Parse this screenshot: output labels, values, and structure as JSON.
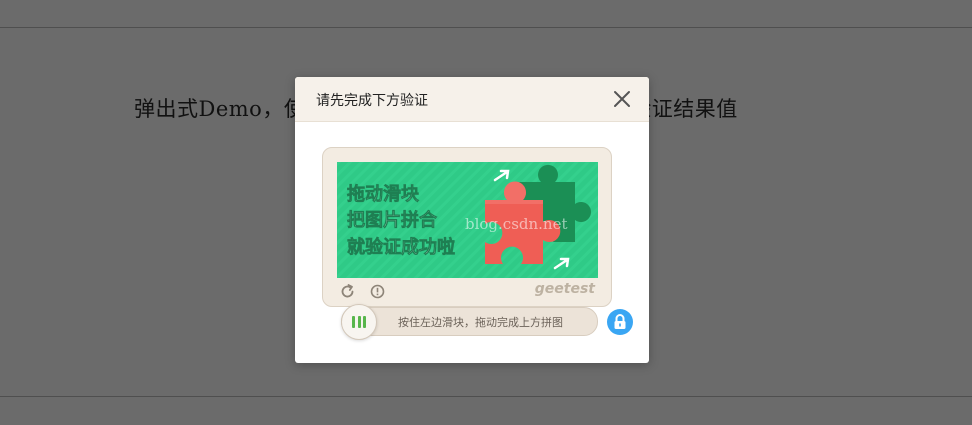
{
  "page": {
    "heading": "弹出式Demo，使用ajax形式提交二次验证码所需的验证结果值"
  },
  "modal": {
    "title": "请先完成下方验证"
  },
  "captcha": {
    "image_lines": [
      "拖动滑块",
      "把图片拼合",
      "就验证成功啦"
    ],
    "watermark": "blog.csdn.net",
    "brand": "geetest",
    "slider_hint": "按住左边滑块，拖动完成上方拼图"
  },
  "icons": {
    "close": "close-icon",
    "refresh": "refresh-icon",
    "info": "info-icon",
    "handle": "grip-icon",
    "lock": "lock-icon"
  },
  "colors": {
    "overlay": "#6b6b6b",
    "captcha_green": "#2fca87",
    "piece_red": "#ef5e55",
    "handle_grip": "#58b64c",
    "lock_blue": "#3aa6f3"
  }
}
